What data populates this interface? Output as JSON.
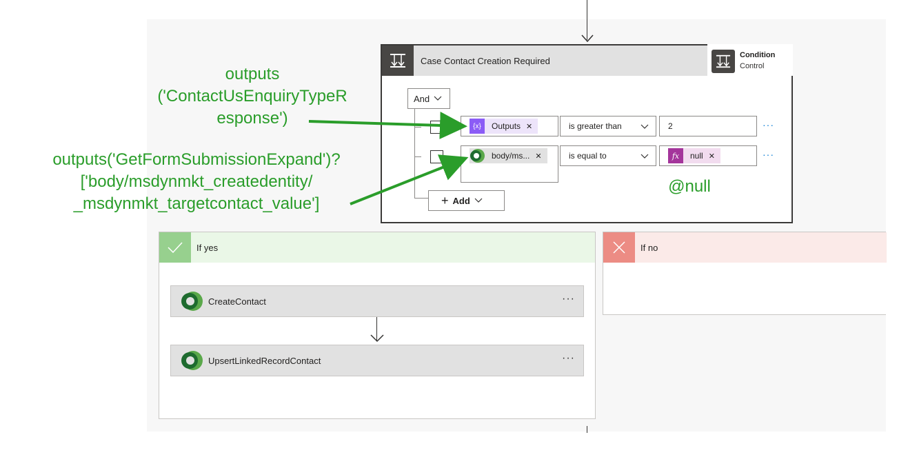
{
  "condition": {
    "title": "Case Contact Creation Required",
    "badge_name": "Condition",
    "badge_type": "Control",
    "group_operator": "And",
    "rows": [
      {
        "operand_left": "Outputs",
        "operator": "is greater than",
        "operand_right": "2"
      },
      {
        "operand_left": "body/ms...",
        "operator": "is equal to",
        "operand_right": "null"
      }
    ],
    "add_label": "Add",
    "more_options": "···"
  },
  "branches": {
    "yes_label": "If yes",
    "no_label": "If no",
    "actions": [
      {
        "label": "CreateContact",
        "more": "···"
      },
      {
        "label": "UpsertLinkedRecordContact",
        "more": "···"
      }
    ]
  },
  "annotations": {
    "outputs_expr_line1": "outputs",
    "outputs_expr_line2": "('ContactUsEnquiryTypeR",
    "outputs_expr_line3": "esponse')",
    "body_expr_line1": "outputs('GetFormSubmissionExpand')?",
    "body_expr_line2": "['body/msdynmkt_createdentity/",
    "body_expr_line3": "_msdynmkt_targetcontact_value']",
    "null_expr": "@null"
  },
  "colors": {
    "annotation": "#2a9d2a",
    "yes_accent": "#97d08e",
    "no_accent": "#ec8c84",
    "variable_token": "#8b5cf6",
    "function_token": "#a4359b"
  },
  "icons": [
    "condition-icon",
    "variable-icon",
    "dataverse-icon",
    "fx-icon",
    "check-icon",
    "close-icon",
    "chevron-down-icon",
    "plus-icon",
    "arrow-down-icon"
  ]
}
